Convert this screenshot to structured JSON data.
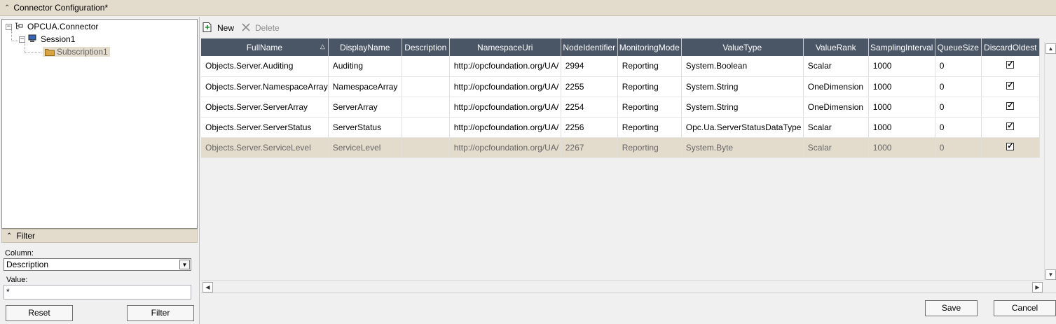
{
  "window": {
    "title": "Connector Configuration*"
  },
  "tree": {
    "root": "OPCUA.Connector",
    "session": "Session1",
    "subscription": "Subscription1"
  },
  "filter": {
    "header": "Filter",
    "column_label": "Column:",
    "column_value": "Description",
    "value_label": "Value:",
    "value_value": "*",
    "reset_label": "Reset",
    "filter_label": "Filter"
  },
  "toolbar": {
    "new_label": "New",
    "delete_label": "Delete"
  },
  "grid": {
    "columns": [
      "FullName",
      "DisplayName",
      "Description",
      "NamespaceUri",
      "NodeIdentifier",
      "MonitoringMode",
      "ValueType",
      "ValueRank",
      "SamplingInterval",
      "QueueSize",
      "DiscardOldest"
    ],
    "sorted_column": "FullName",
    "rows": [
      {
        "FullName": "Objects.Server.Auditing",
        "DisplayName": "Auditing",
        "Description": "",
        "NamespaceUri": "http://opcfoundation.org/UA/",
        "NodeIdentifier": "2994",
        "MonitoringMode": "Reporting",
        "ValueType": "System.Boolean",
        "ValueRank": "Scalar",
        "SamplingInterval": "1000",
        "QueueSize": "0",
        "DiscardOldest": true
      },
      {
        "FullName": "Objects.Server.NamespaceArray",
        "DisplayName": "NamespaceArray",
        "Description": "",
        "NamespaceUri": "http://opcfoundation.org/UA/",
        "NodeIdentifier": "2255",
        "MonitoringMode": "Reporting",
        "ValueType": "System.String",
        "ValueRank": "OneDimension",
        "SamplingInterval": "1000",
        "QueueSize": "0",
        "DiscardOldest": true
      },
      {
        "FullName": "Objects.Server.ServerArray",
        "DisplayName": "ServerArray",
        "Description": "",
        "NamespaceUri": "http://opcfoundation.org/UA/",
        "NodeIdentifier": "2254",
        "MonitoringMode": "Reporting",
        "ValueType": "System.String",
        "ValueRank": "OneDimension",
        "SamplingInterval": "1000",
        "QueueSize": "0",
        "DiscardOldest": true
      },
      {
        "FullName": "Objects.Server.ServerStatus",
        "DisplayName": "ServerStatus",
        "Description": "",
        "NamespaceUri": "http://opcfoundation.org/UA/",
        "NodeIdentifier": "2256",
        "MonitoringMode": "Reporting",
        "ValueType": "Opc.Ua.ServerStatusDataType",
        "ValueRank": "Scalar",
        "SamplingInterval": "1000",
        "QueueSize": "0",
        "DiscardOldest": true
      },
      {
        "FullName": "Objects.Server.ServiceLevel",
        "DisplayName": "ServiceLevel",
        "Description": "",
        "NamespaceUri": "http://opcfoundation.org/UA/",
        "NodeIdentifier": "2267",
        "MonitoringMode": "Reporting",
        "ValueType": "System.Byte",
        "ValueRank": "Scalar",
        "SamplingInterval": "1000",
        "QueueSize": "0",
        "DiscardOldest": true
      }
    ],
    "selected_row_index": 4
  },
  "footer": {
    "save_label": "Save",
    "cancel_label": "Cancel"
  },
  "colors": {
    "header_bg": "#4a5566",
    "accent": "#e3dccd"
  }
}
